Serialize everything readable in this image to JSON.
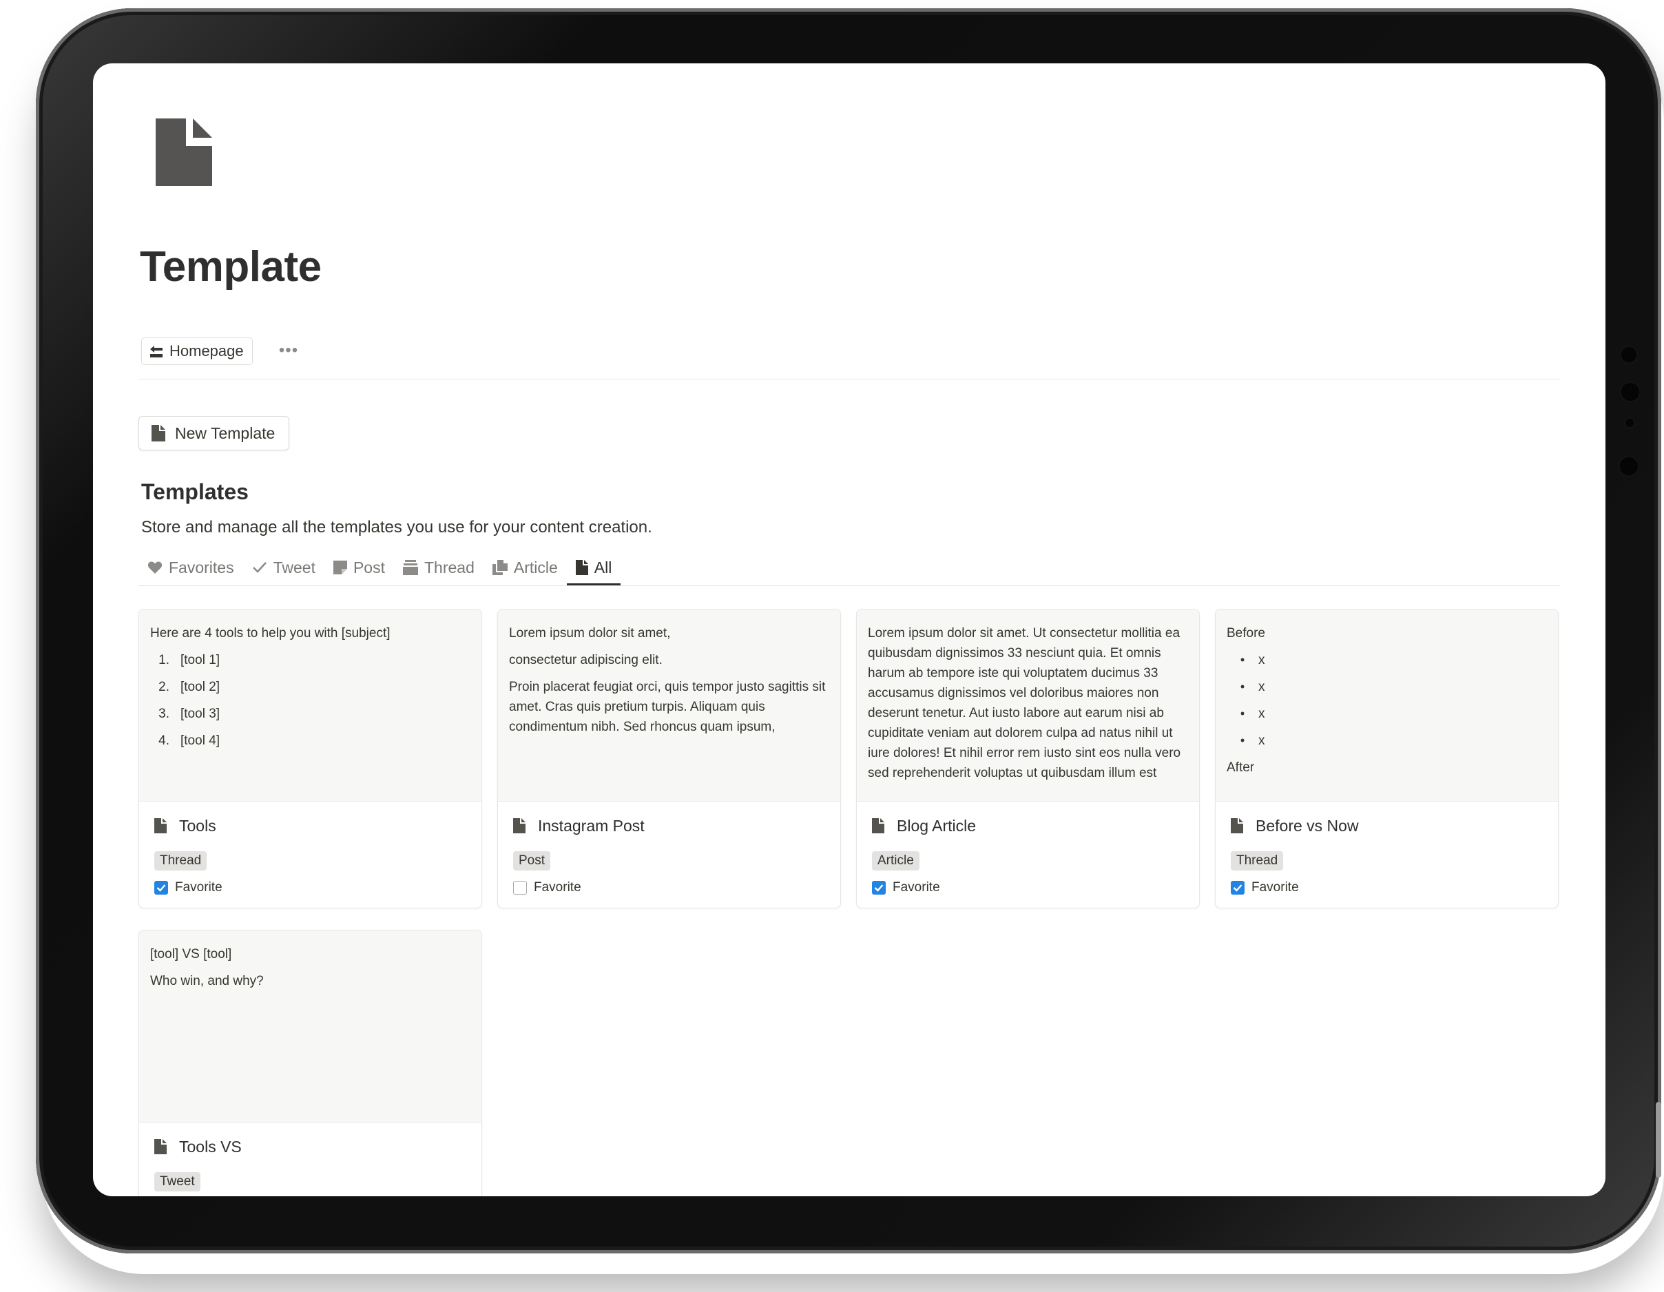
{
  "page": {
    "title": "Template",
    "breadcrumb_label": "Homepage",
    "more_label": "•••"
  },
  "new_button": {
    "label": "New Template"
  },
  "section": {
    "title": "Templates",
    "description": "Store and manage all the templates you use for your content creation."
  },
  "tabs": [
    {
      "label": "Favorites",
      "icon": "heart-icon"
    },
    {
      "label": "Tweet",
      "icon": "check-icon"
    },
    {
      "label": "Post",
      "icon": "note-icon"
    },
    {
      "label": "Thread",
      "icon": "stack-icon"
    },
    {
      "label": "Article",
      "icon": "documents-icon"
    },
    {
      "label": "All",
      "icon": "document-icon",
      "active": true
    }
  ],
  "cards": [
    {
      "title": "Tools",
      "tag": "Thread",
      "favorite_label": "Favorite",
      "favorite": true,
      "preview": {
        "intro": "Here are 4 tools to help you with [subject]",
        "items": [
          {
            "num": "1.",
            "text": "[tool 1]"
          },
          {
            "num": "2.",
            "text": "[tool 2]"
          },
          {
            "num": "3.",
            "text": "[tool 3]"
          },
          {
            "num": "4.",
            "text": "[tool 4]"
          }
        ]
      }
    },
    {
      "title": "Instagram Post",
      "tag": "Post",
      "favorite_label": "Favorite",
      "favorite": false,
      "preview": {
        "line1": "Lorem ipsum dolor sit amet,",
        "line2": "consectetur adipiscing elit.",
        "para": "Proin placerat feugiat orci, quis tempor justo sagittis sit amet. Cras quis pretium turpis. Aliquam quis condimentum nibh. Sed rhoncus quam ipsum,"
      }
    },
    {
      "title": "Blog Article",
      "tag": "Article",
      "favorite_label": "Favorite",
      "favorite": true,
      "preview": {
        "para": "Lorem ipsum dolor sit amet. Ut consectetur mollitia ea quibusdam dignissimos 33 nesciunt quia. Et omnis harum ab tempore iste qui voluptatem ducimus 33 accusamus dignissimos vel doloribus maiores non deserunt tenetur. Aut iusto labore aut earum nisi ab cupiditate veniam aut dolorem culpa ad natus nihil ut iure dolores! Et nihil error rem iusto sint eos nulla vero sed reprehenderit voluptas ut quibusdam illum est"
      }
    },
    {
      "title": "Before vs Now",
      "tag": "Thread",
      "favorite_label": "Favorite",
      "favorite": true,
      "preview": {
        "before": "Before",
        "bullets": [
          "x",
          "x",
          "x",
          "x"
        ],
        "after": "After"
      }
    },
    {
      "title": "Tools VS",
      "tag": "Tweet",
      "preview": {
        "line1": "[tool] VS [tool]",
        "line2": "Who win, and why?"
      }
    }
  ]
}
